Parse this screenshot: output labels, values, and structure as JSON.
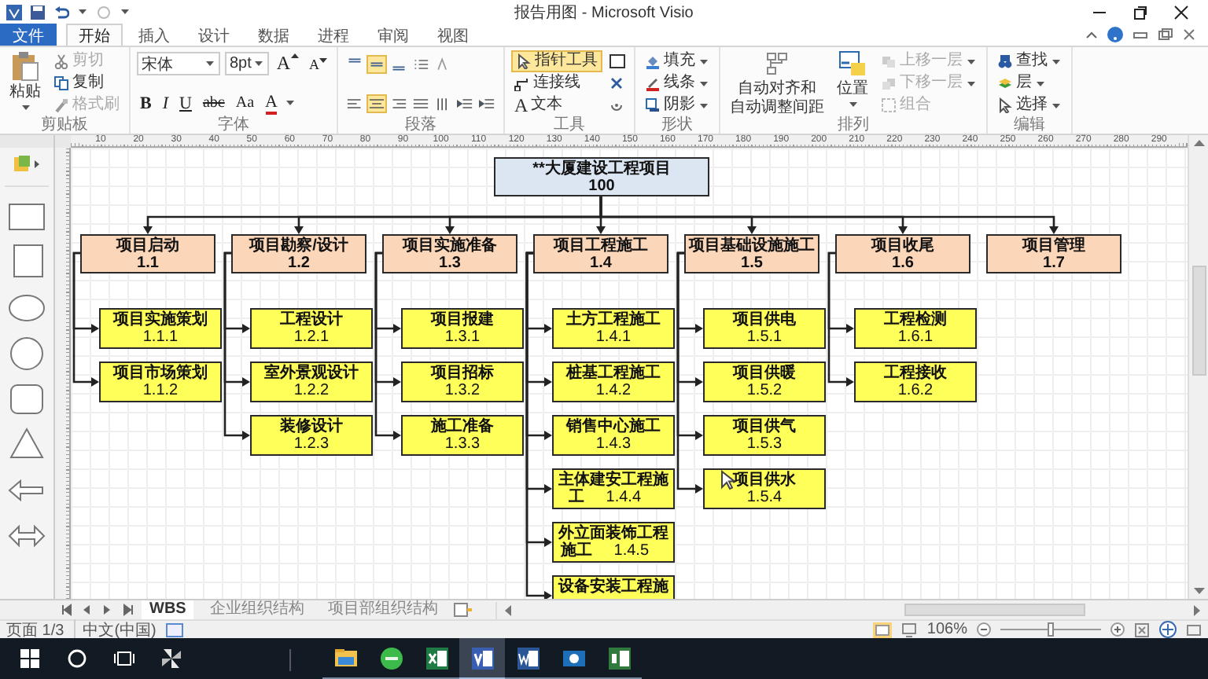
{
  "window": {
    "title": "报告用图 - Microsoft Visio"
  },
  "ribbon_tabs": [
    {
      "label": "文件",
      "kind": "file",
      "selected": false
    },
    {
      "label": "开始",
      "kind": "tab",
      "selected": true
    },
    {
      "label": "插入",
      "kind": "tab",
      "selected": false
    },
    {
      "label": "设计",
      "kind": "tab",
      "selected": false
    },
    {
      "label": "数据",
      "kind": "tab",
      "selected": false
    },
    {
      "label": "进程",
      "kind": "tab",
      "selected": false
    },
    {
      "label": "审阅",
      "kind": "tab",
      "selected": false
    },
    {
      "label": "视图",
      "kind": "tab",
      "selected": false
    }
  ],
  "clipboard": {
    "title": "剪贴板",
    "paste": "粘贴",
    "items": [
      {
        "label": "剪切",
        "kind": "cut",
        "disabled": true
      },
      {
        "label": "复制",
        "kind": "copy",
        "disabled": false
      },
      {
        "label": "格式刷",
        "kind": "painter",
        "disabled": true
      }
    ]
  },
  "font": {
    "title": "字体",
    "font_name": "宋体",
    "font_size": "8pt",
    "buttons": [
      {
        "label": "A",
        "kind": "grow"
      },
      {
        "label": "A",
        "kind": "shrink"
      },
      {
        "label": "B",
        "kind": "bold"
      },
      {
        "label": "I",
        "kind": "italic"
      },
      {
        "label": "U",
        "kind": "underline"
      },
      {
        "label": "abc",
        "kind": "strike"
      },
      {
        "label": "Aa",
        "kind": "case"
      },
      {
        "label": "A",
        "kind": "color"
      }
    ]
  },
  "paragraph": {
    "title": "段落",
    "rows": [
      [
        {
          "kind": "align-top",
          "selected": false
        },
        {
          "kind": "align-middle",
          "selected": true
        },
        {
          "kind": "align-bottom",
          "selected": false
        },
        {
          "kind": "bullets",
          "selected": false
        },
        {
          "kind": "grow",
          "selected": false
        }
      ],
      [
        {
          "kind": "align-left",
          "selected": false
        },
        {
          "kind": "align-center",
          "selected": true
        },
        {
          "kind": "align-right",
          "selected": false
        },
        {
          "kind": "justify",
          "selected": false
        },
        {
          "kind": "direction",
          "selected": false
        },
        {
          "kind": "outdent",
          "selected": false
        },
        {
          "kind": "indent",
          "selected": false
        }
      ]
    ]
  },
  "tools": {
    "title": "工具",
    "items": [
      {
        "label": "指针工具",
        "kind": "pointer",
        "selected": true
      },
      {
        "label": "连接线",
        "kind": "connector",
        "selected": false
      },
      {
        "label": "文本",
        "kind": "text",
        "glyph": "A",
        "selected": false
      }
    ]
  },
  "shape": {
    "title": "形状",
    "items": [
      {
        "label": "填充",
        "kind": "fill"
      },
      {
        "label": "线条",
        "kind": "line"
      },
      {
        "label": "阴影",
        "kind": "shadow"
      }
    ]
  },
  "arrange": {
    "title": "排列",
    "items": [
      {
        "label_lines": [
          "自动对齐和",
          "自动调整间距"
        ],
        "kind": "auto-align",
        "disabled": false
      },
      {
        "label": "位置",
        "kind": "position",
        "disabled": false
      },
      {
        "label": "上移一层",
        "kind": "forward",
        "disabled": true
      },
      {
        "label": "下移一层",
        "kind": "backward",
        "disabled": true
      },
      {
        "label": "组合",
        "kind": "group",
        "disabled": true
      }
    ]
  },
  "editing": {
    "title": "编辑",
    "items": [
      {
        "label": "查找",
        "kind": "find"
      },
      {
        "label": "层",
        "kind": "layer"
      },
      {
        "label": "选择",
        "kind": "select"
      }
    ]
  },
  "ruler": {
    "labels": [
      "10",
      "20",
      "30",
      "40",
      "50",
      "60",
      "70",
      "80",
      "90",
      "100",
      "110",
      "120",
      "130",
      "140",
      "150",
      "160",
      "170",
      "180",
      "190",
      "200",
      "210",
      "220",
      "230",
      "240",
      "250",
      "260",
      "270",
      "280",
      "290"
    ]
  },
  "diagram": {
    "root": {
      "name": "**大厦建设工程项目",
      "code": "100"
    },
    "branches": [
      {
        "name": "项目启动",
        "code": "1.1",
        "children": [
          {
            "name": "项目实施策划",
            "code": "1.1.1"
          },
          {
            "name": "项目市场策划",
            "code": "1.1.2"
          }
        ]
      },
      {
        "name": "项目勘察/设计",
        "code": "1.2",
        "children": [
          {
            "name": "工程设计",
            "code": "1.2.1"
          },
          {
            "name": "室外景观设计",
            "code": "1.2.2"
          },
          {
            "name": "装修设计",
            "code": "1.2.3"
          }
        ]
      },
      {
        "name": "项目实施准备",
        "code": "1.3",
        "children": [
          {
            "name": "项目报建",
            "code": "1.3.1"
          },
          {
            "name": "项目招标",
            "code": "1.3.2"
          },
          {
            "name": "施工准备",
            "code": "1.3.3"
          }
        ]
      },
      {
        "name": "项目工程施工",
        "code": "1.4",
        "children": [
          {
            "name": "土方工程施工",
            "code": "1.4.1"
          },
          {
            "name": "桩基工程施工",
            "code": "1.4.2"
          },
          {
            "name": "销售中心施工",
            "code": "1.4.3"
          },
          {
            "name": "主体建安工程施工",
            "code": "1.4.4"
          },
          {
            "name": "外立面装饰工程施工",
            "code": "1.4.5"
          },
          {
            "name": "设备安装工程施"
          }
        ]
      },
      {
        "name": "项目基础设施施工",
        "code": "1.5",
        "children": [
          {
            "name": "项目供电",
            "code": "1.5.1"
          },
          {
            "name": "项目供暖",
            "code": "1.5.2"
          },
          {
            "name": "项目供气",
            "code": "1.5.3"
          },
          {
            "name": "项目供水",
            "code": "1.5.4"
          }
        ]
      },
      {
        "name": "项目收尾",
        "code": "1.6",
        "children": [
          {
            "name": "工程检测",
            "code": "1.6.1"
          },
          {
            "name": "工程接收",
            "code": "1.6.2"
          }
        ]
      },
      {
        "name": "项目管理",
        "code": "1.7"
      }
    ]
  },
  "sheet_tabs": [
    {
      "label": "WBS",
      "selected": true
    },
    {
      "label": "企业组织结构",
      "selected": false
    },
    {
      "label": "项目部组织结构",
      "selected": false
    }
  ],
  "status_bar": {
    "page": "页面 1/3",
    "language": "中文(中国)",
    "zoom": "106%",
    "zoom_slider": {
      "level": 0.5
    }
  },
  "taskbar": {
    "apps": [
      {
        "kind": "explorer",
        "selected": false
      },
      {
        "kind": "green",
        "selected": false
      },
      {
        "kind": "excel",
        "selected": false
      },
      {
        "kind": "visio",
        "selected": true
      },
      {
        "kind": "word",
        "selected": false
      },
      {
        "kind": "camera",
        "selected": false
      },
      {
        "kind": "project",
        "selected": false
      }
    ]
  }
}
